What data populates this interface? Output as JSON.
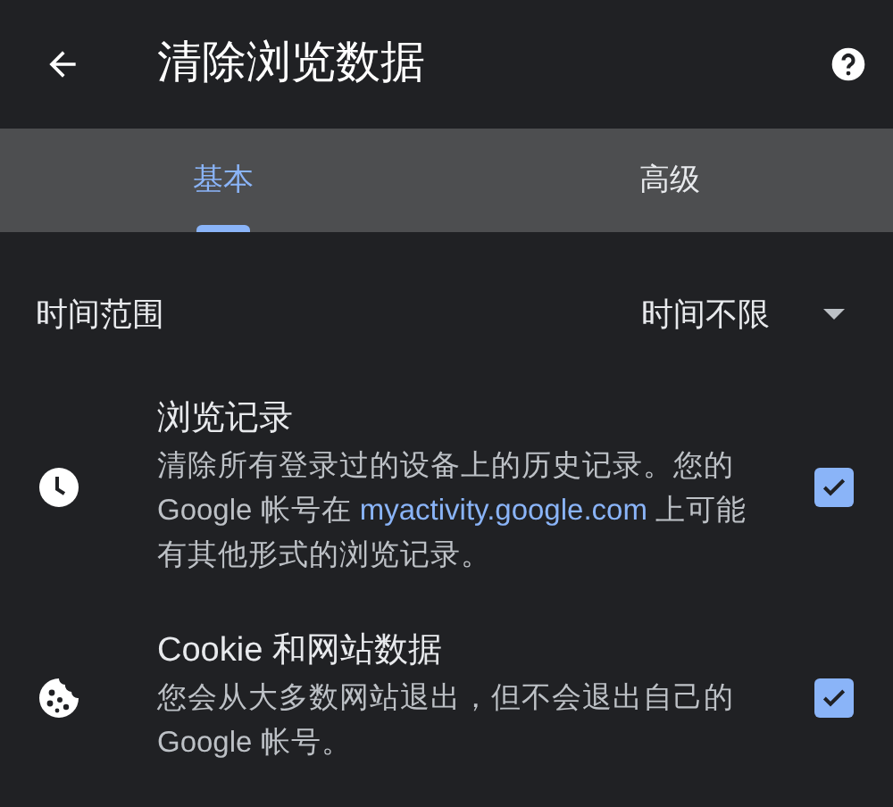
{
  "header": {
    "title": "清除浏览数据"
  },
  "tabs": [
    {
      "label": "基本",
      "selected": true
    },
    {
      "label": "高级",
      "selected": false
    }
  ],
  "time_range": {
    "label": "时间范围",
    "value": "时间不限"
  },
  "items": [
    {
      "kind": "history",
      "title": "浏览记录",
      "description_before": "清除所有登录过的设备上的历史记录。您的 Google 帐号在 ",
      "link": "myactivity.google.com",
      "description_after": " 上可能有其他形式的浏览记录。",
      "checked": true
    },
    {
      "kind": "cookies",
      "title": "Cookie 和网站数据",
      "description_before": "您会从大多数网站退出，但不会退出自己的 Google 帐号。",
      "checked": true
    }
  ]
}
